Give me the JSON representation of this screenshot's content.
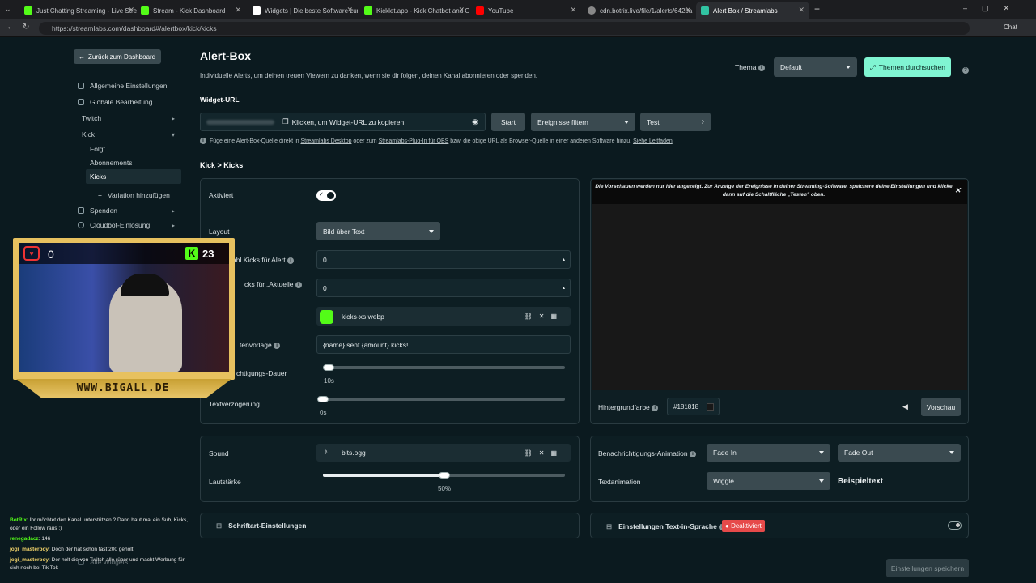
{
  "browser": {
    "tabs": [
      {
        "label": "Just Chatting Streaming - Live Stre",
        "color": "#53fc18"
      },
      {
        "label": "Stream - Kick Dashboard",
        "color": "#53fc18"
      },
      {
        "label": "Widgets | Die beste Software zur O",
        "color": "#ffffff"
      },
      {
        "label": "Kicklet.app - Kick Chatbot and Ov",
        "color": "#53fc18"
      },
      {
        "label": "YouTube",
        "color": "#ff0000"
      },
      {
        "label": "cdn.botrix.live/file/1/alerts/642ba",
        "color": "#888888"
      },
      {
        "label": "Alert Box / Streamlabs",
        "color": "#31c3a2"
      }
    ],
    "url": "https://streamlabs.com/dashboard#/alertbox/kick/kicks",
    "chat_button": "Chat"
  },
  "sidebar": {
    "back": "Zurück zum Dashboard",
    "items": [
      {
        "label": "Allgemeine Einstellungen"
      },
      {
        "label": "Globale Bearbeitung"
      },
      {
        "label": "Twitch"
      },
      {
        "label": "Kick"
      },
      {
        "label": "Folgt"
      },
      {
        "label": "Abonnements"
      },
      {
        "label": "Kicks"
      },
      {
        "label": "Variation hinzufügen"
      },
      {
        "label": "Spenden"
      },
      {
        "label": "Cloudbot-Einlösung"
      },
      {
        "label": "Alle Widgets"
      }
    ]
  },
  "header": {
    "title": "Alert-Box",
    "subtitle": "Individuelle Alerts, um deinen treuen Viewern zu danken, wenn sie dir folgen, deinen Kanal abonnieren oder spenden.",
    "theme_label": "Thema",
    "theme_value": "Default",
    "browse_themes": "Themen durchsuchen"
  },
  "widget_url": {
    "label": "Widget-URL",
    "copy_text": "Klicken, um Widget-URL zu kopieren",
    "start": "Start",
    "filter": "Ereignisse filtern",
    "test": "Test",
    "hint_1": "Füge eine Alert-Box-Quelle direkt in ",
    "hint_link_1": "Streamlabs Desktop",
    "hint_2": " oder zum ",
    "hint_link_2": "Streamlabs-Plug-In für OBS",
    "hint_3": " bzw. die obige URL als Browser-Quelle in einer anderen Software hinzu.",
    "hint_link_3": "Siehe Leitfaden"
  },
  "section": {
    "breadcrumb": "Kick > Kicks",
    "enabled_label": "Aktiviert",
    "layout_label": "Layout",
    "layout_value": "Bild über Text",
    "min_kicks_label": "ahl Kicks für Alert",
    "min_kicks_value": "0",
    "current_label": "cks für „Aktuelle",
    "current_value": "0",
    "image_value": "kicks-xs.webp",
    "template_label": "tenvorlage",
    "template_value": "{name} sent {amount} kicks!",
    "duration_label": "chtigungs-Dauer",
    "duration_value": "10s",
    "duration_fraction": 0.0,
    "text_delay_label": "Textverzögerung",
    "text_delay_value": "0s",
    "text_delay_fraction": 0.0
  },
  "preview": {
    "notice": "Die Vorschauen werden nur hier angezeigt. Zur Anzeige der Ereignisse in deiner Streaming-Software, speichere deine Einstellungen und klicke dann auf die Schaltfläche „Testen\" oben.",
    "bg_label": "Hintergrundfarbe",
    "bg_value": "#181818",
    "preview_button": "Vorschau"
  },
  "sound": {
    "label": "Sound",
    "file": "bits.ogg",
    "volume_label": "Lautstärke",
    "volume_value": "50%",
    "volume_fraction": 0.5
  },
  "animation": {
    "label": "Benachrichtigungs-Animation",
    "in": "Fade In",
    "out": "Fade Out",
    "text_label": "Textanimation",
    "text_value": "Wiggle",
    "sample": "Beispieltext"
  },
  "font_settings": "Schriftart-Einstellungen",
  "tts": {
    "label": "Einstellungen Text-in-Sprache",
    "badge": "Deaktiviert"
  },
  "save": "Einstellungen speichern",
  "overlay": {
    "heart_count": "0",
    "kick_count": "23",
    "banner": "WWW.BIGALL.DE"
  },
  "chat": [
    {
      "user": "BotRix",
      "text": ": Ihr möchtet den Kanal unterstützen ? Dann haut mal ein Sub, Kicks, oder ein Follow raus :)"
    },
    {
      "user": "renegadacz",
      "text": ": 146"
    },
    {
      "user": "jogi_masterboy",
      "text": ": Doch der hat schon fast 200 geholt"
    },
    {
      "user": "jogi_masterboy",
      "text": ": Der holt die von Twitch alle rüber und macht Werbung für sich noch bei Tik Tok"
    }
  ]
}
